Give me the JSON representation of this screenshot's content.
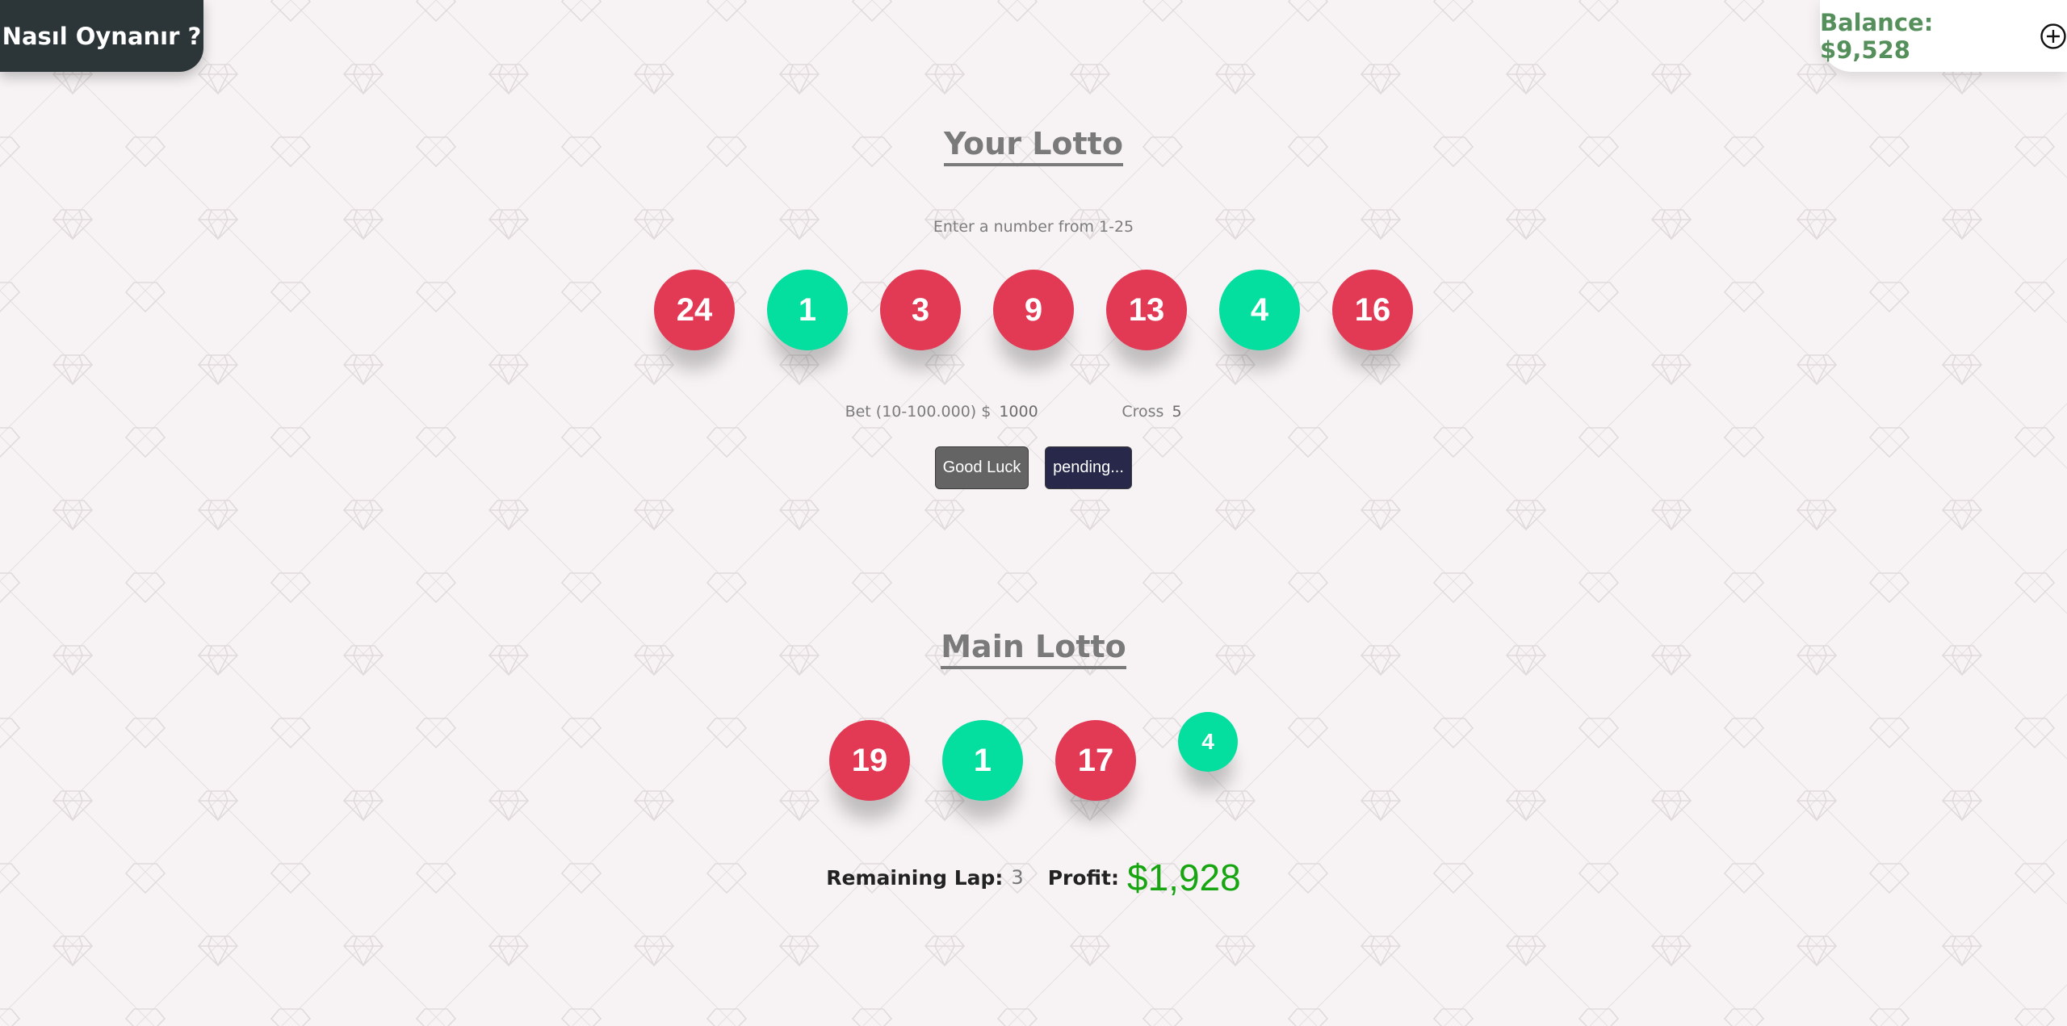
{
  "header": {
    "howto_label": "Nasıl Oynanır ?",
    "balance_label": "Balance: $9,528"
  },
  "your_lotto": {
    "title": "Your Lotto",
    "hint": "Enter a number from 1-25",
    "balls": [
      {
        "value": "24",
        "color": "red"
      },
      {
        "value": "1",
        "color": "green"
      },
      {
        "value": "3",
        "color": "red"
      },
      {
        "value": "9",
        "color": "red"
      },
      {
        "value": "13",
        "color": "red"
      },
      {
        "value": "4",
        "color": "green"
      },
      {
        "value": "16",
        "color": "red"
      }
    ],
    "bet_label": "Bet (10-100.000) $",
    "bet_value": "1000",
    "cross_label": "Cross",
    "cross_value": "5",
    "good_luck_label": "Good Luck",
    "pending_label": "pending..."
  },
  "main_lotto": {
    "title": "Main Lotto",
    "balls": [
      {
        "value": "19",
        "color": "red"
      },
      {
        "value": "1",
        "color": "green"
      },
      {
        "value": "17",
        "color": "red"
      },
      {
        "value": "4",
        "color": "green"
      }
    ],
    "remaining_label": "Remaining Lap:",
    "remaining_value": "3",
    "profit_label": "Profit:",
    "profit_value": "$1,928"
  },
  "colors": {
    "red": "#e23a55",
    "green": "#04de9e",
    "balance_text": "#55905c",
    "profit": "#17a511"
  },
  "icons": {
    "add_balance": "plus-circle-icon",
    "background": "diamond-pattern"
  }
}
